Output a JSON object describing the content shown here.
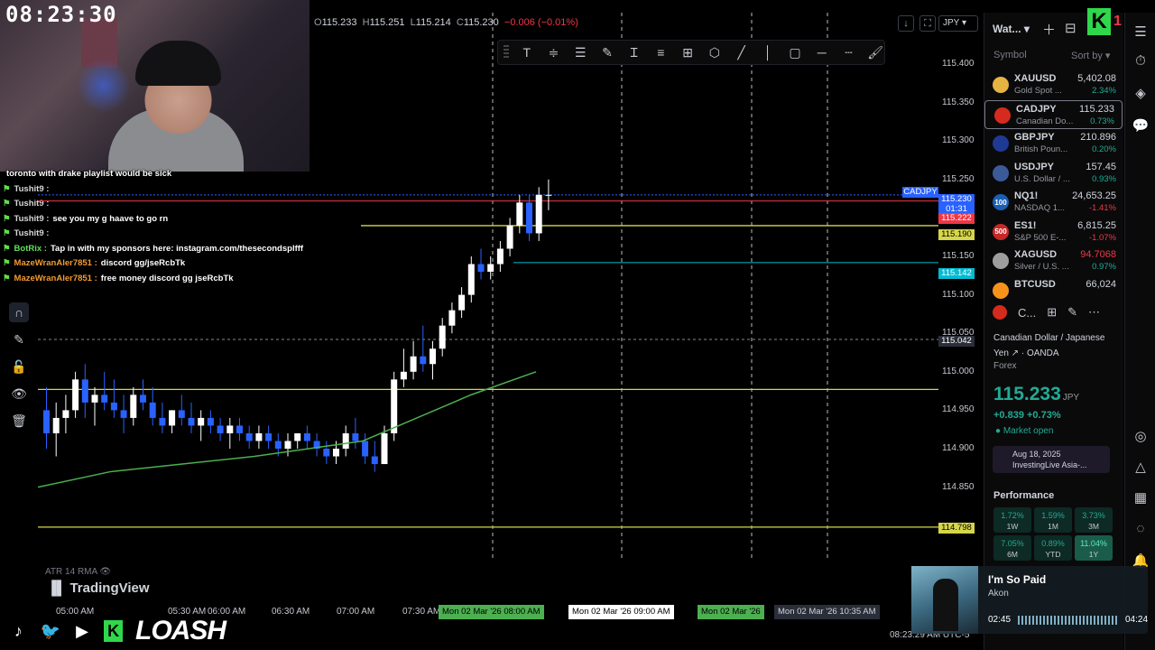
{
  "stream": {
    "clock": "08:23:30",
    "chat": [
      {
        "user": "",
        "text": "toronto with drake playlist would be sick",
        "color": "user"
      },
      {
        "user": "Tushit9 :",
        "text": "",
        "color": "user"
      },
      {
        "user": "Tushit9 :",
        "text": "",
        "color": "user"
      },
      {
        "user": "Tushit9 :",
        "text": "see you my g haave to go rn",
        "color": "user"
      },
      {
        "user": "Tushit9 :",
        "text": "",
        "color": "user"
      },
      {
        "user": "BotRix :",
        "text": "Tap in with my sponsors here: instagram.com/thesecondsplfff",
        "color": "u-green"
      },
      {
        "user": "MazeWranAler7851 :",
        "text": "discord gg/jseRcbTk",
        "color": "u-orange"
      },
      {
        "user": "MazeWranAler7851 :",
        "text": "free money discord gg jseRcbTk",
        "color": "u-orange"
      }
    ],
    "brand": "LOASH",
    "brand_k": "K"
  },
  "chart": {
    "ohlc": {
      "o_label": "O",
      "o": "115.233",
      "h_label": "H",
      "h": "115.251",
      "l_label": "L",
      "l": "115.214",
      "c_label": "C",
      "c": "115.230",
      "change": "−0.006 (−0.01%)"
    },
    "currency": "JPY",
    "indicator": "ATR 14 RMA",
    "logo": "TradingView",
    "price_levels": [
      "115.400",
      "115.350",
      "115.300",
      "115.250",
      "115.200",
      "115.150",
      "115.100",
      "115.050",
      "115.000",
      "114.950",
      "114.900",
      "114.850"
    ],
    "tags": {
      "symbol": "CADJPY",
      "last": "115.230",
      "countdown": "01:31",
      "red": "115.222",
      "yellow1": "115.190",
      "cyan": "115.142",
      "cursor": "115.042",
      "yellow2": "114.798"
    },
    "time_labels": [
      "05:00 AM",
      "05:30 AM",
      "06:00 AM",
      "06:30 AM",
      "07:00 AM",
      "07:30 AM"
    ],
    "time_highlights": [
      "Mon 02 Mar '26   08:00 AM",
      "Mon 02 Mar '26   09:00 AM",
      "Mon 02 Mar '26",
      "Mon 02 Mar '26   10:35 AM"
    ],
    "bottom_clock": "08:23:29 AM UTC-5",
    "colors": {
      "up": "#ffffff",
      "down": "#2962ff",
      "ma": "#4caf50",
      "yellow": "#d6d64a",
      "red": "#f23645",
      "cyan": "#00bcd4"
    }
  },
  "watchlist": {
    "title": "Wat...",
    "col_symbol": "Symbol",
    "col_sort": "Sort by",
    "items": [
      {
        "sym": "XAUUSD",
        "desc": "Gold Spot ...",
        "last": "5,402.08",
        "chg": "2.34%",
        "dir": "pos",
        "icon": "gold",
        "iconColor": "#e5b342"
      },
      {
        "sym": "CADJPY",
        "desc": "Canadian Do...",
        "last": "115.233",
        "chg": "0.73%",
        "dir": "pos",
        "icon": "flag",
        "iconColor": "#d52b1e",
        "selected": true
      },
      {
        "sym": "GBPJPY",
        "desc": "British Poun...",
        "last": "210.896",
        "chg": "0.20%",
        "dir": "pos",
        "icon": "flag",
        "iconColor": "#1f3a93"
      },
      {
        "sym": "USDJPY",
        "desc": "U.S. Dollar / ...",
        "last": "157.45",
        "chg": "0.93%",
        "dir": "pos",
        "icon": "flag",
        "iconColor": "#3c5a99"
      },
      {
        "sym": "NQ1!",
        "desc": "NASDAQ 1...",
        "last": "24,653.25",
        "chg": "-1.41%",
        "dir": "neg",
        "icon": "100",
        "iconColor": "#1a5fb4"
      },
      {
        "sym": "ES1!",
        "desc": "S&P 500 E-...",
        "last": "6,815.25",
        "chg": "-1.07%",
        "dir": "neg",
        "icon": "500",
        "iconColor": "#c62828"
      },
      {
        "sym": "XAGUSD",
        "desc": "Silver / U.S. ...",
        "last": "94.7068",
        "chg": "0.97%",
        "dir": "pos",
        "icon": "silver",
        "iconColor": "#9e9e9e",
        "lastNeg": true
      },
      {
        "sym": "BTCUSD",
        "desc": "",
        "last": "66,024",
        "chg": "",
        "dir": "pos",
        "icon": "btc",
        "iconColor": "#f7931a"
      }
    ]
  },
  "detail": {
    "short": "C...",
    "name": "Canadian Dollar / Japanese Yen",
    "broker": "OANDA",
    "type": "Forex",
    "price": "115.233",
    "price_ccy": "JPY",
    "change": "+0.839  +0.73%",
    "market": "Market open",
    "news_date": "Aug 18, 2025",
    "news_title": "InvestingLive Asia-...",
    "performance_title": "Performance",
    "performance": [
      {
        "v": "1.72%",
        "p": "1W"
      },
      {
        "v": "1.59%",
        "p": "1M"
      },
      {
        "v": "3.73%",
        "p": "3M"
      },
      {
        "v": "7.05%",
        "p": "6M"
      },
      {
        "v": "0.89%",
        "p": "YTD"
      },
      {
        "v": "11.04%",
        "p": "1Y",
        "hi": true
      }
    ]
  },
  "music": {
    "title": "I'm So Paid",
    "artist": "Akon",
    "elapsed": "02:45",
    "total": "04:24"
  },
  "badge": {
    "k": "K",
    "count": "1"
  }
}
